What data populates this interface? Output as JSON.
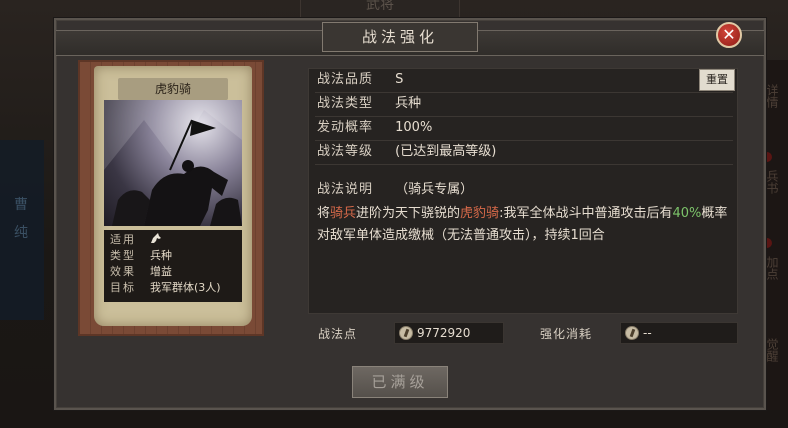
{
  "background": {
    "top_title": "武将",
    "left_strip": [
      "曹",
      "纯"
    ],
    "right_strip": [
      "详情",
      "兵书",
      "加点",
      "觉醒"
    ]
  },
  "dialog": {
    "title": "战法强化",
    "close_label": "✕",
    "reset_label": "重置"
  },
  "card": {
    "name": "虎豹骑",
    "info": [
      {
        "key": "适用",
        "value": ""
      },
      {
        "key": "类型",
        "value": "兵种"
      },
      {
        "key": "效果",
        "value": "增益"
      },
      {
        "key": "目标",
        "value": "我军群体(3人)"
      }
    ]
  },
  "tactic": {
    "quality_label": "战法品质",
    "quality": "S",
    "type_label": "战法类型",
    "type": "兵种",
    "rate_label": "发动概率",
    "rate": "100%",
    "level_label": "战法等级",
    "level": "(已达到最高等级)",
    "desc_label": "战法说明",
    "desc_tag": "（骑兵专属）",
    "desc_part1": "将",
    "desc_hl1": "骑兵",
    "desc_part2": "进阶为天下骁锐的",
    "desc_hl2": "虎豹骑",
    "desc_part3": ":我军全体战斗中普通攻击后有",
    "desc_hl3": "40%",
    "desc_part4": "概率对敌军单体造成缴械（无法普通攻击），持续1回合"
  },
  "points": {
    "points_label": "战法点",
    "points_value": "9772920",
    "cost_label": "强化消耗",
    "cost_value": "--"
  },
  "action": {
    "upgrade_label": "已满级"
  },
  "colors": {
    "accent_red": "#d86a4a",
    "accent_green": "#7cc36a",
    "close_red": "#c0392b"
  }
}
